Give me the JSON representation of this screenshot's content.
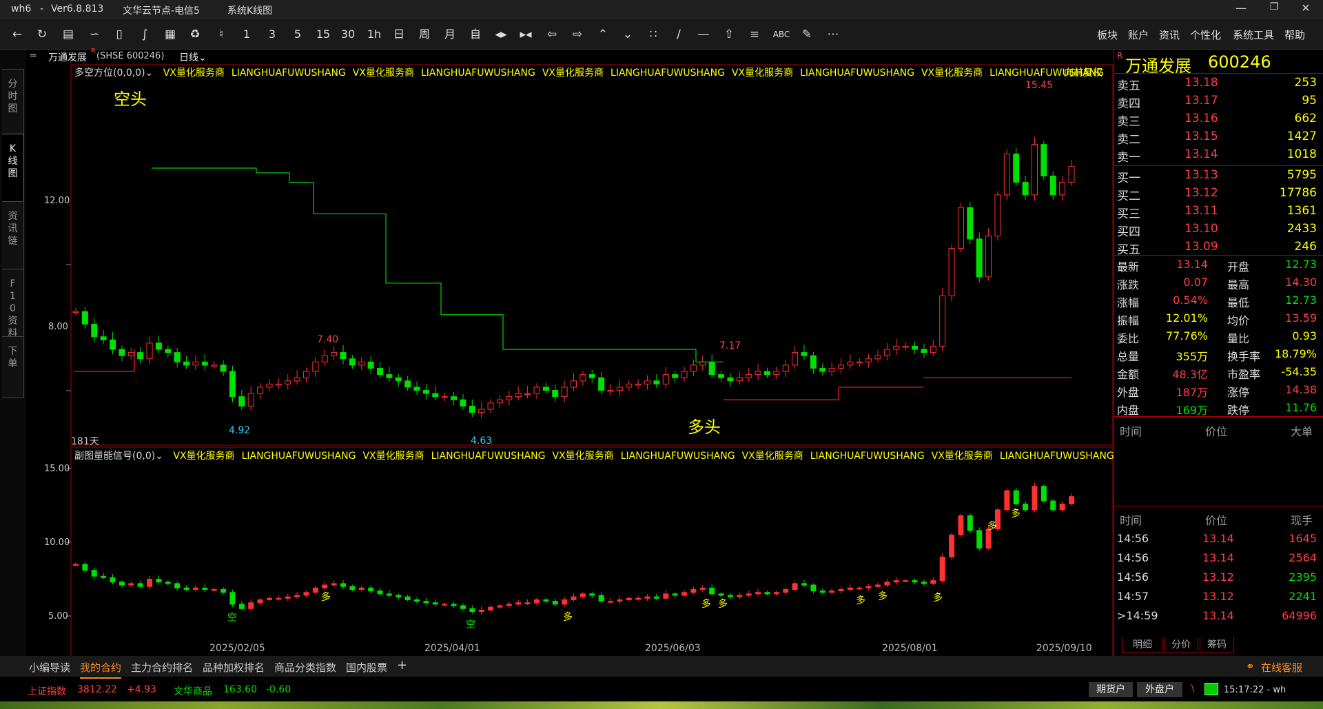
{
  "titlebar": {
    "app": "wh6",
    "version": "Ver6.8.813",
    "node": "文华云节点-电信5",
    "view": "系统K线图"
  },
  "toolbar": {
    "numbers": [
      "1",
      "3",
      "5",
      "15",
      "30",
      "1h"
    ],
    "day": "日",
    "week": "周",
    "month": "月",
    "custom": "自",
    "menus": [
      "板块",
      "账户",
      "资讯",
      "个性化",
      "系统工具",
      "帮助"
    ]
  },
  "left_tabs": [
    "分时图",
    "K线图",
    "资讯链",
    "F10资料",
    "下单"
  ],
  "chart_header": {
    "name": "万通发展",
    "flag": "R",
    "code": "(SHSE 600246)",
    "period": "日线"
  },
  "main_indicator": {
    "name": "多空方位(0,0,0)",
    "watermark": [
      "VX量化服务商",
      "LIANGHUAFUWUSHANG",
      "VX量化服务商",
      "LIANGHUAFUWUSHANG",
      "VX量化服务商",
      "LIANGHUAFUWUSHANG",
      "VX量化服务商",
      "LIANGHUAFUWUSHANG",
      "VX量化服务商",
      "LIANGHUAFUWUSHANG"
    ],
    "adjust": "向前复权",
    "kong_label": "空头",
    "duo_label": "多头",
    "days": "181天",
    "marks": {
      "high1": "7.40",
      "low1": "4.92",
      "low2": "4.63",
      "high2": "7.17",
      "top": "15.45"
    },
    "y_labels": [
      "12.00",
      "8.00"
    ]
  },
  "sub_indicator": {
    "name": "副图量能信号(0,0)",
    "watermark": [
      "VX量化服务商",
      "LIANGHUAFUWUSHANG",
      "VX量化服务商",
      "LIANGHUAFUWUSHANG",
      "VX量化服务商",
      "LIANGHUAFUWUSHANG",
      "VX量化服务商",
      "LIANGHUAFUWUSHANG",
      "VX量化服务商",
      "LIANGHUAFUWUSHANG"
    ],
    "y_labels": [
      "15.00",
      "10.00",
      "5.00"
    ],
    "duo": "多",
    "kong": "空"
  },
  "x_labels": [
    "2025/02/05",
    "2025/04/01",
    "2025/06/03",
    "2025/08/01",
    "2025/09/10"
  ],
  "quote": {
    "flag": "R",
    "name": "万通发展",
    "code": "600246",
    "asks": [
      {
        "label": "卖五",
        "price": "13.18",
        "vol": "253"
      },
      {
        "label": "卖四",
        "price": "13.17",
        "vol": "95"
      },
      {
        "label": "卖三",
        "price": "13.16",
        "vol": "662"
      },
      {
        "label": "卖二",
        "price": "13.15",
        "vol": "1427"
      },
      {
        "label": "卖一",
        "price": "13.14",
        "vol": "1018"
      }
    ],
    "bids": [
      {
        "label": "买一",
        "price": "13.13",
        "vol": "5795"
      },
      {
        "label": "买二",
        "price": "13.12",
        "vol": "17786"
      },
      {
        "label": "买三",
        "price": "13.11",
        "vol": "1361"
      },
      {
        "label": "买四",
        "price": "13.10",
        "vol": "2433"
      },
      {
        "label": "买五",
        "price": "13.09",
        "vol": "246"
      }
    ],
    "stats": [
      {
        "l1": "最新",
        "v1": "13.14",
        "c1": "#ff4040",
        "l2": "开盘",
        "v2": "12.73",
        "c2": "#00e000"
      },
      {
        "l1": "涨跌",
        "v1": "0.07",
        "c1": "#ff4040",
        "l2": "最高",
        "v2": "14.30",
        "c2": "#ff4040"
      },
      {
        "l1": "涨幅",
        "v1": "0.54%",
        "c1": "#ff4040",
        "l2": "最低",
        "v2": "12.73",
        "c2": "#00e000"
      },
      {
        "l1": "振幅",
        "v1": "12.01%",
        "c1": "#ffff00",
        "l2": "均价",
        "v2": "13.59",
        "c2": "#ff4040"
      },
      {
        "l1": "委比",
        "v1": "77.76%",
        "c1": "#ffff00",
        "l2": "量比",
        "v2": "0.93",
        "c2": "#ffff00"
      },
      {
        "l1": "总量",
        "v1": "355万",
        "c1": "#ffff00",
        "l2": "换手率",
        "v2": "18.79%",
        "c2": "#ffff00"
      },
      {
        "l1": "金额",
        "v1": "48.3亿",
        "c1": "#ff4040",
        "l2": "市盈率",
        "v2": "-54.35",
        "c2": "#ffff00"
      },
      {
        "l1": "外盘",
        "v1": "187万",
        "c1": "#ff4040",
        "l2": "涨停",
        "v2": "14.38",
        "c2": "#ff4040"
      },
      {
        "l1": "内盘",
        "v1": "169万",
        "c1": "#00e000",
        "l2": "跌停",
        "v2": "11.76",
        "c2": "#00e000"
      }
    ],
    "big_header": [
      "时间",
      "价位",
      "大单"
    ],
    "tick_header": [
      "时间",
      "价位",
      "现手"
    ],
    "ticks": [
      {
        "time": "14:56",
        "price": "13.14",
        "vol": "1645",
        "pc": "#ff4040",
        "vc": "#ff4040"
      },
      {
        "time": "14:56",
        "price": "13.14",
        "vol": "2564",
        "pc": "#ff4040",
        "vc": "#ff4040"
      },
      {
        "time": "14:56",
        "price": "13.12",
        "vol": "2395",
        "pc": "#ff4040",
        "vc": "#00e000"
      },
      {
        "time": "14:57",
        "price": "13.12",
        "vol": "2241",
        "pc": "#ff4040",
        "vc": "#00e000"
      },
      {
        "time": ">14:59",
        "price": "13.14",
        "vol": "64996",
        "pc": "#ff4040",
        "vc": "#ff4040"
      }
    ],
    "tabs": [
      "明细",
      "分价",
      "筹码"
    ]
  },
  "bottom_tabs": [
    "小编导读",
    "我的合约",
    "主力合约排名",
    "品种加权排名",
    "商品分类指数",
    "国内股票"
  ],
  "service": "在线客服",
  "status": {
    "idx1_name": "上证指数",
    "idx1_val": "3812.22",
    "idx1_chg": "+4.93",
    "idx2_name": "文华商品",
    "idx2_val": "163.60",
    "idx2_chg": "-0.60",
    "btn1": "期货户",
    "btn2": "外盘户",
    "time": "15:17:22 - wh"
  },
  "chart_data": {
    "type": "candlestick",
    "x_ticks": [
      "2025/02/05",
      "2025/04/01",
      "2025/06/03",
      "2025/08/01",
      "2025/09/10"
    ],
    "y_ticks_main": [
      12.0,
      8.0
    ],
    "y_ticks_sub": [
      15.0,
      10.0,
      5.0
    ],
    "annotations": [
      {
        "label": "7.40",
        "type": "high"
      },
      {
        "label": "4.92",
        "type": "low"
      },
      {
        "label": "4.63",
        "type": "low"
      },
      {
        "label": "7.17",
        "type": "high"
      },
      {
        "label": "15.45",
        "type": "high"
      }
    ],
    "closes": [
      8.5,
      8.1,
      7.7,
      7.6,
      7.3,
      7.1,
      7.2,
      7.0,
      7.5,
      7.3,
      7.2,
      6.9,
      6.8,
      6.9,
      6.8,
      6.8,
      6.6,
      5.8,
      5.5,
      5.9,
      6.1,
      6.2,
      6.2,
      6.3,
      6.4,
      6.6,
      6.9,
      7.1,
      7.2,
      7.0,
      6.8,
      6.9,
      6.7,
      6.5,
      6.4,
      6.3,
      6.1,
      6.0,
      5.9,
      5.8,
      5.8,
      5.7,
      5.5,
      5.3,
      5.4,
      5.6,
      5.7,
      5.8,
      5.9,
      5.9,
      6.1,
      6.0,
      5.8,
      6.1,
      6.3,
      6.5,
      6.4,
      6.0,
      6.0,
      6.1,
      6.2,
      6.2,
      6.3,
      6.2,
      6.5,
      6.4,
      6.6,
      6.8,
      6.9,
      6.5,
      6.4,
      6.3,
      6.4,
      6.5,
      6.6,
      6.5,
      6.6,
      6.8,
      7.2,
      7.1,
      6.7,
      6.6,
      6.7,
      6.8,
      6.9,
      6.9,
      7.0,
      7.1,
      7.3,
      7.4,
      7.4,
      7.3,
      7.2,
      7.4,
      9.0,
      10.5,
      11.8,
      10.8,
      9.6,
      10.9,
      12.2,
      13.5,
      12.6,
      12.2,
      13.8,
      12.8,
      12.2,
      12.6,
      13.1
    ],
    "long_short_line": {
      "short_levels": [
        13.05,
        12.9,
        12.6,
        11.6,
        9.4,
        8.4,
        7.3,
        6.9
      ],
      "long_levels": [
        6.6,
        5.7,
        6.1,
        6.4
      ]
    }
  }
}
